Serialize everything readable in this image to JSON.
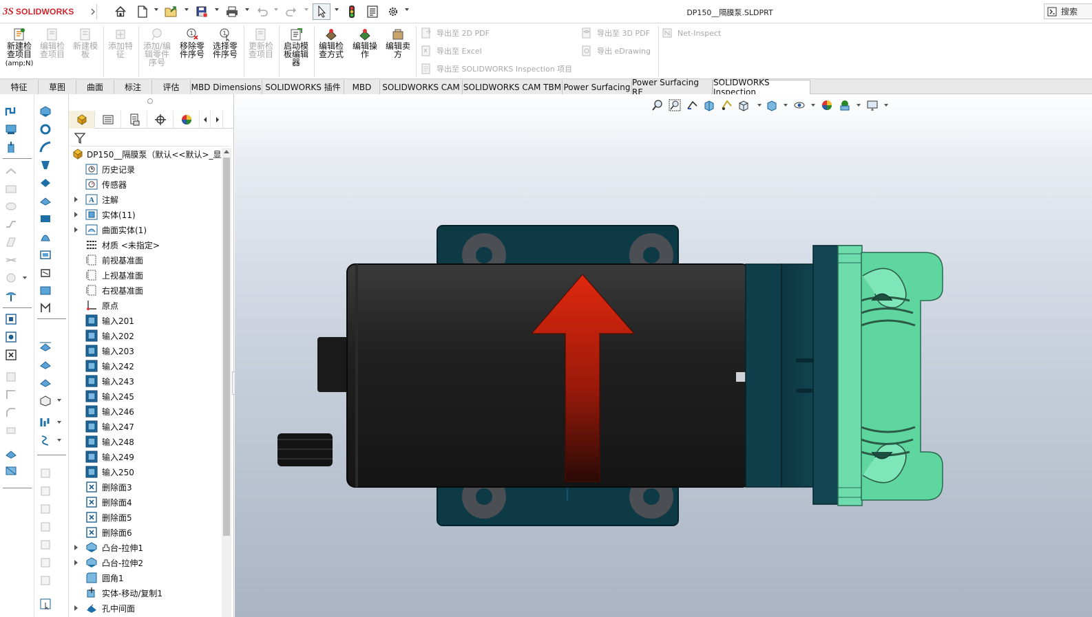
{
  "app": {
    "brand_prefix": "3S",
    "brand_name": "SOLIDWORKS"
  },
  "document_title": "DP150__隔膜泵.SLDPRT",
  "search": {
    "label": "搜索"
  },
  "command_manager": {
    "new_inspection": {
      "label": "新建检\n查项目",
      "shortcut": "(amp;N)"
    },
    "edit_inspection": "编辑检\n查项目",
    "new_template": "新建模\n板",
    "add_feature": "添加特\n征",
    "add_edit_balloon": "添加/编\n辑零件\n序号",
    "remove_balloon": "移除零\n件序号",
    "select_balloon": "选择零\n件序号",
    "update_inspection": "更新检\n查项目",
    "launch_template_editor": "启动模\n板编辑\n器",
    "edit_inspection_method": "编辑检\n查方式",
    "edit_operation": "编辑操\n作",
    "edit_vendor": "编辑卖\n方",
    "export_2d_pdf": "导出至 2D PDF",
    "export_excel": "导出至 Excel",
    "export_sw_inspection": "导出至 SOLIDWORKS Inspection 项目",
    "export_3d_pdf": "导出至 3D PDF",
    "export_edrawing": "导出 eDrawing",
    "net_inspect": "Net-Inspect"
  },
  "tabs": [
    "特征",
    "草图",
    "曲面",
    "标注",
    "评估",
    "MBD Dimensions",
    "SOLIDWORKS 插件",
    "MBD",
    "SOLIDWORKS CAM",
    "SOLIDWORKS CAM TBM",
    "Power Surfacing",
    "Power Surfacing RE",
    "SOLIDWORKS Inspection"
  ],
  "feature_tree": {
    "root": "DP150__隔膜泵（默认<<默认>_显示",
    "items": [
      "历史记录",
      "传感器",
      "注解",
      "实体(11)",
      "曲面实体(1)",
      "材质 <未指定>",
      "前视基准面",
      "上视基准面",
      "右视基准面",
      "原点",
      "输入201",
      "输入202",
      "输入203",
      "输入242",
      "输入243",
      "输入245",
      "输入246",
      "输入247",
      "输入248",
      "输入249",
      "输入250",
      "删除面3",
      "删除面4",
      "删除面5",
      "删除面6",
      "凸台-拉伸1",
      "凸台-拉伸2",
      "圆角1",
      "实体-移动/复制1",
      "孔中间面"
    ]
  },
  "colors": {
    "brand": "#d2232a",
    "motor_body": "#1e1e1e",
    "flange": "#0f3f4a",
    "pump_head": "#5fd6a0",
    "arrow": "#d42a12"
  }
}
